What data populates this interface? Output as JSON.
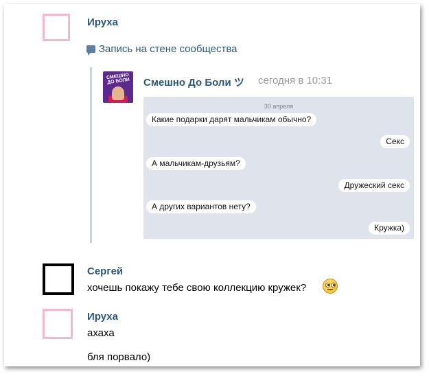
{
  "messages": [
    {
      "author": "Ируха",
      "wall_note": "Запись на стене сообщества"
    },
    {
      "author": "Сергей",
      "text": "хочешь покажу тебе свою коллекцию кружек?"
    },
    {
      "author": "Ируха",
      "text": "ахаха",
      "text2": "бля порвало)"
    }
  ],
  "repost": {
    "group_name": "Смешно До Боли ツ",
    "time": "сегодня в 10:31",
    "group_logo_text": "СМЕШНО ДО БОЛИ",
    "chat": {
      "date": "30 апреля",
      "bubbles": [
        {
          "side": "left",
          "text": "Какие подарки дарят мальчикам обычно?"
        },
        {
          "side": "right",
          "text": "Секс"
        },
        {
          "side": "left",
          "text": "А мальчикам-друзьям?"
        },
        {
          "side": "right",
          "text": "Дружеский секс"
        },
        {
          "side": "left",
          "text": "А других вариантов нету?"
        },
        {
          "side": "right",
          "text": "Кружка)"
        }
      ]
    }
  },
  "icons": {
    "wall_note": "speech-bubble-icon",
    "emoji": "rolling-eyes-emoji-icon"
  },
  "colors": {
    "link": "#2b587a",
    "muted": "#999999",
    "chat_bg": "#dfe4ec",
    "avatar_pink": "#f4b8cb"
  }
}
